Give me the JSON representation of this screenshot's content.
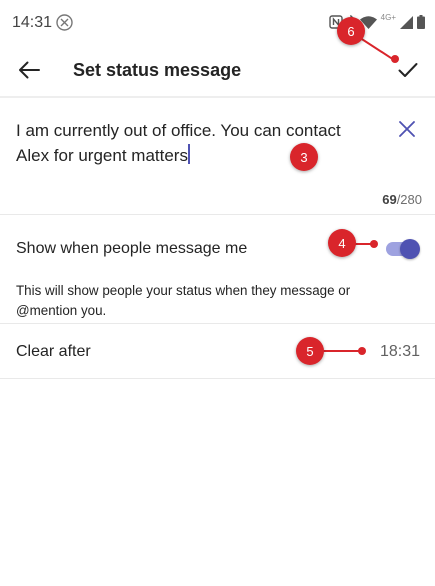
{
  "status_bar": {
    "time": "14:31",
    "network_label": "4G+"
  },
  "header": {
    "title": "Set status message"
  },
  "message": {
    "text": "I am currently out of office. You can contact Alex for urgent matters",
    "char_count": "69",
    "char_limit": "/280"
  },
  "toggle": {
    "label": "Show when people message me",
    "description": "This will show people your status when they message or @mention you.",
    "state": "on"
  },
  "clear_after": {
    "label": "Clear after",
    "value": "18:31"
  },
  "callouts": [
    "3",
    "4",
    "5",
    "6"
  ],
  "colors": {
    "accent": "#4f52b2",
    "accent_light": "#9ea2e0",
    "callout": "#d9252b"
  }
}
